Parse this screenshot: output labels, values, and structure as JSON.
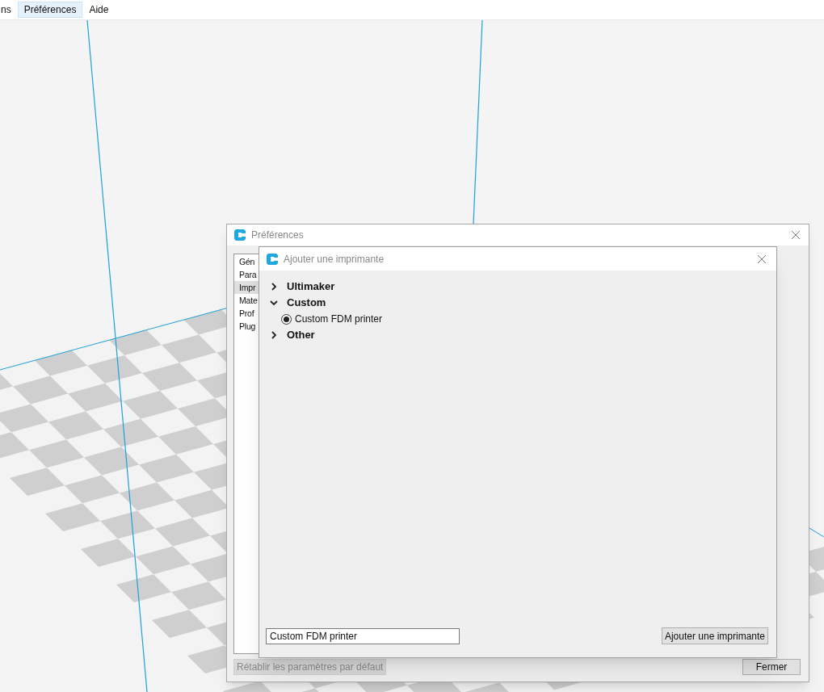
{
  "menu_bar": {
    "items": [
      {
        "label": "ns",
        "selected": false
      },
      {
        "label": "Préférences",
        "selected": true
      },
      {
        "label": "Aide",
        "selected": false
      }
    ]
  },
  "preferences_dialog": {
    "title": "Préférences",
    "sidebar": {
      "items": [
        {
          "label": "Gén",
          "selected": false
        },
        {
          "label": "Para",
          "selected": false
        },
        {
          "label": "Impr",
          "selected": true
        },
        {
          "label": "Mate",
          "selected": false
        },
        {
          "label": "Prof",
          "selected": false
        },
        {
          "label": "Plug",
          "selected": false
        }
      ]
    },
    "reset_button": {
      "label": "Rétablir les paramètres par défaut",
      "disabled": true
    },
    "close_button": {
      "label": "Fermer"
    }
  },
  "add_printer_dialog": {
    "title": "Ajouter une imprimante",
    "tree": [
      {
        "label": "Ultimaker",
        "expanded": false
      },
      {
        "label": "Custom",
        "expanded": true,
        "children": [
          {
            "label": "Custom FDM printer",
            "selected": true
          }
        ]
      },
      {
        "label": "Other",
        "expanded": false
      }
    ],
    "name_field": {
      "value": "Custom FDM printer"
    },
    "add_button": {
      "label": "Ajouter une imprimante"
    }
  }
}
